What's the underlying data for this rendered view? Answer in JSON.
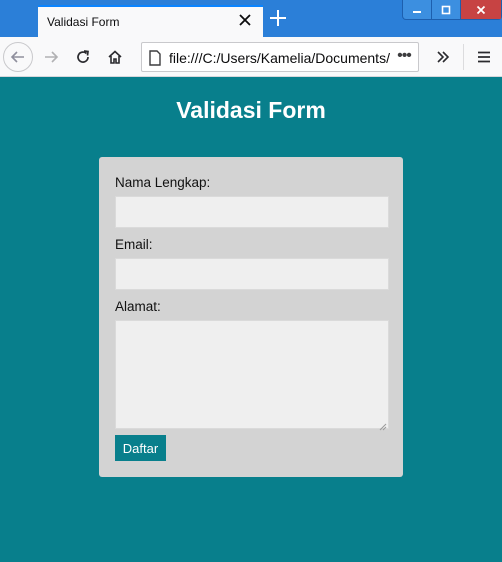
{
  "browser": {
    "tab_title": "Validasi Form",
    "url": "file:///C:/Users/Kamelia/Documents/",
    "url_more": "•••",
    "accent": "#0a84ff"
  },
  "page": {
    "heading": "Validasi Form",
    "background": "#087f8c",
    "card_background": "#d3d3d3"
  },
  "form": {
    "name_label": "Nama Lengkap:",
    "name_value": "",
    "email_label": "Email:",
    "email_value": "",
    "address_label": "Alamat:",
    "address_value": "",
    "submit_label": "Daftar"
  }
}
